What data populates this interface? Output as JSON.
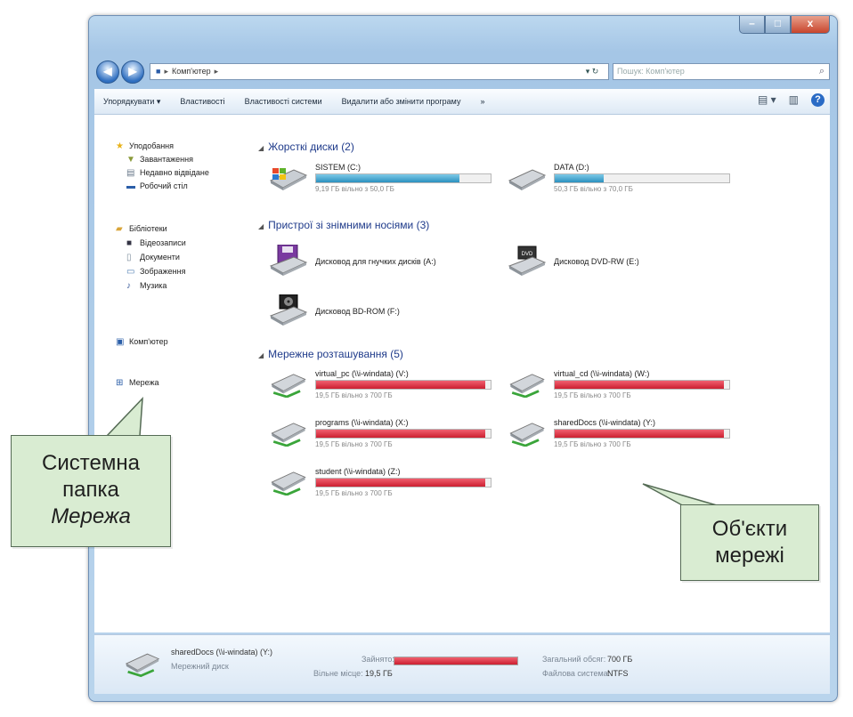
{
  "window": {
    "controls": {
      "minimize": "–",
      "maximize": "□",
      "close": "x"
    },
    "nav": {
      "back": "◀",
      "forward": "▶"
    },
    "address": {
      "root_icon": "computer-icon",
      "location": "Комп'ютер"
    },
    "refresh": "▾ ↻",
    "search_placeholder": "Пошук: Комп'ютер"
  },
  "toolbar": {
    "organize": "Упорядкувати ▾",
    "properties": "Властивості",
    "system_properties": "Властивості системи",
    "uninstall": "Видалити або змінити програму",
    "more": "»",
    "views": "▤ ▾",
    "preview": "▥",
    "help": "?"
  },
  "sidebar": {
    "favorites": "Уподобання",
    "downloads": "Завантаження",
    "recent": "Недавно відвідане",
    "desktop": "Робочий стіл",
    "libraries": "Бібліотеки",
    "videos": "Відеозаписи",
    "documents": "Документи",
    "pictures": "Зображення",
    "music": "Музика",
    "computer": "Комп'ютер",
    "network": "Мережа"
  },
  "groups": {
    "hard_disks": "Жорсткі диски (2)",
    "removable": "Пристрої зі знімними носіями (3)",
    "network": "Мережне розташування (5)"
  },
  "hard_disks": [
    {
      "name": "SISTEM (C:)",
      "free": "9,19 ГБ вільно з 50,0 ГБ",
      "used_fraction": 0.82
    },
    {
      "name": "DATA (D:)",
      "free": "50,3 ГБ вільно з 70,0 ГБ",
      "used_fraction": 0.28
    }
  ],
  "removable": [
    {
      "name": "Дисковод для гнучких дисків (A:)"
    },
    {
      "name": "Дисковод DVD-RW (E:)"
    },
    {
      "name": "Дисковод BD-ROM (F:)"
    }
  ],
  "network_drives": [
    {
      "name": "virtual_pc (\\\\i-windata) (V:)",
      "free": "19,5 ГБ вільно з 700 ГБ",
      "used_fraction": 0.97
    },
    {
      "name": "virtual_cd (\\\\i-windata) (W:)",
      "free": "19,5 ГБ вільно з 700 ГБ",
      "used_fraction": 0.97
    },
    {
      "name": "programs (\\\\i-windata) (X:)",
      "free": "19,5 ГБ вільно з 700 ГБ",
      "used_fraction": 0.97
    },
    {
      "name": "sharedDocs (\\\\i-windata) (Y:)",
      "free": "19,5 ГБ вільно з 700 ГБ",
      "used_fraction": 0.97
    },
    {
      "name": "student (\\\\i-windata) (Z:)",
      "free": "19,5 ГБ вільно з 700 ГБ",
      "used_fraction": 0.97
    }
  ],
  "status": {
    "name": "sharedDocs (\\\\i-windata) (Y:)",
    "type": "Мережний диск",
    "used_label": "Зайнято:",
    "free_label": "Вільне місце:",
    "free_value": "19,5 ГБ",
    "total_label": "Загальний обсяг:",
    "total_value": "700 ГБ",
    "fs_label": "Файлова система:",
    "fs_value": "NTFS"
  },
  "callouts": {
    "network_folder": {
      "line1": "Системна",
      "line2": "папка",
      "line3": "Мережа"
    },
    "network_objects": {
      "line1": "Об'єкти",
      "line2": "мережі"
    }
  },
  "colors": {
    "used_blue": "#2b91bf",
    "used_red": "#cc1f30",
    "group_header": "#1e3a8a",
    "callout_bg": "#d9ecd2"
  }
}
